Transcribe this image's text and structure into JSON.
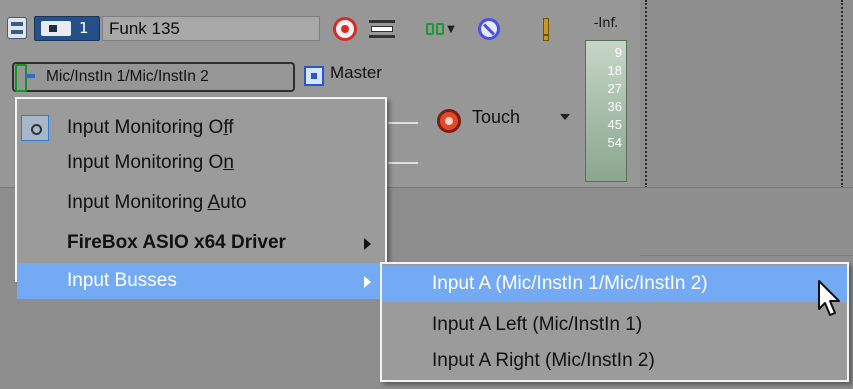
{
  "track": {
    "number": "1",
    "name": "Funk 135",
    "input": "Mic/InstIn 1/Mic/InstIn 2",
    "output": "Master",
    "automation_mode": "Touch"
  },
  "meter": {
    "peak_label": "-Inf.",
    "scale": [
      "9",
      "18",
      "27",
      "36",
      "45",
      "54"
    ]
  },
  "menu": {
    "items": [
      {
        "pre": "Input Monitoring O",
        "u": "f",
        "post": "f"
      },
      {
        "pre": "Input Monitoring O",
        "u": "n",
        "post": ""
      },
      {
        "pre": "Input Monitoring ",
        "u": "A",
        "post": "uto"
      },
      {
        "pre": "FireBox ASIO x64 Driver",
        "u": "",
        "post": ""
      },
      {
        "pre": "Input Busses",
        "u": "",
        "post": ""
      }
    ],
    "submenu": [
      "Input A (Mic/InstIn 1/Mic/InstIn 2)",
      "Input A Left (Mic/InstIn 1)",
      "Input A Right (Mic/InstIn 2)"
    ]
  },
  "icons": {
    "track_type": "track-type-icon",
    "arm": "record-arm-icon",
    "monitor": "input-monitor-icon",
    "fx": "track-fx-icon",
    "mute": "mute-icon",
    "solo": "solo-icon",
    "input_routing": "input-routing-icon",
    "output": "output-bus-icon",
    "automation": "automation-icon",
    "cursor": "mouse-pointer-icon"
  },
  "colors": {
    "highlight": "#74aaf4",
    "record": "#d62b2b",
    "mute": "#4a52e0"
  }
}
